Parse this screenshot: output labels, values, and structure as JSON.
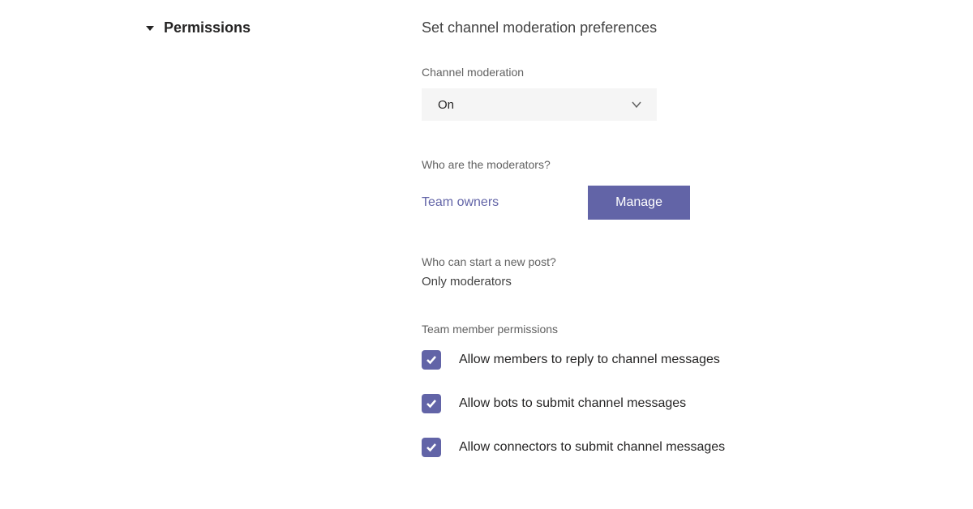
{
  "section": {
    "title": "Permissions",
    "subtitle": "Set channel moderation preferences"
  },
  "moderation": {
    "label": "Channel moderation",
    "value": "On"
  },
  "moderators": {
    "label": "Who are the moderators?",
    "value": "Team owners",
    "manage_button": "Manage"
  },
  "newPost": {
    "label": "Who can start a new post?",
    "value": "Only moderators"
  },
  "memberPermissions": {
    "label": "Team member permissions",
    "items": [
      {
        "label": "Allow members to reply to channel messages",
        "checked": true
      },
      {
        "label": "Allow bots to submit channel messages",
        "checked": true
      },
      {
        "label": "Allow connectors to submit channel messages",
        "checked": true
      }
    ]
  }
}
